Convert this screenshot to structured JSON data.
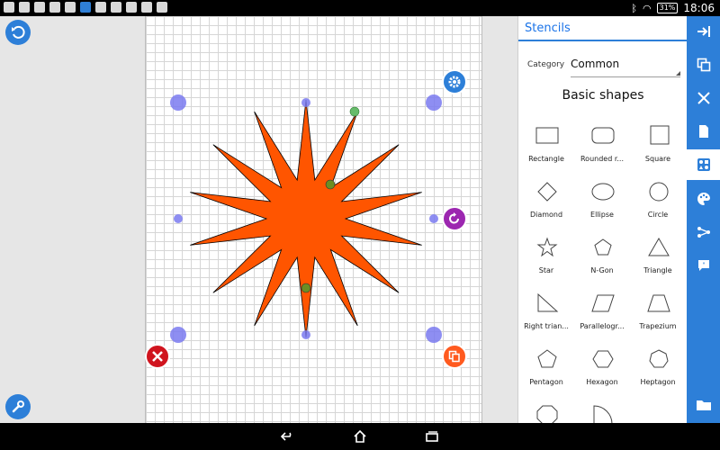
{
  "status": {
    "battery": "31%",
    "time": "18:06"
  },
  "stencils": {
    "title": "Stencils",
    "category_label": "Category",
    "category_value": "Common",
    "section_title": "Basic shapes",
    "shapes": [
      {
        "label": "Rectangle",
        "icon": "rectangle-shape-icon"
      },
      {
        "label": "Rounded r...",
        "icon": "rounded-rectangle-shape-icon"
      },
      {
        "label": "Square",
        "icon": "square-shape-icon"
      },
      {
        "label": "Diamond",
        "icon": "diamond-shape-icon"
      },
      {
        "label": "Ellipse",
        "icon": "ellipse-shape-icon"
      },
      {
        "label": "Circle",
        "icon": "circle-shape-icon"
      },
      {
        "label": "Star",
        "icon": "star-shape-icon"
      },
      {
        "label": "N-Gon",
        "icon": "ngon-shape-icon"
      },
      {
        "label": "Triangle",
        "icon": "triangle-shape-icon"
      },
      {
        "label": "Right trian...",
        "icon": "right-triangle-shape-icon"
      },
      {
        "label": "Parallelogr...",
        "icon": "parallelogram-shape-icon"
      },
      {
        "label": "Trapezium",
        "icon": "trapezium-shape-icon"
      },
      {
        "label": "Pentagon",
        "icon": "pentagon-shape-icon"
      },
      {
        "label": "Hexagon",
        "icon": "hexagon-shape-icon"
      },
      {
        "label": "Heptagon",
        "icon": "heptagon-shape-icon"
      },
      {
        "label": "",
        "icon": "octagon-shape-icon"
      },
      {
        "label": "",
        "icon": "quarter-circle-shape-icon"
      }
    ]
  },
  "colors": {
    "accent": "#2d7fd8",
    "star_fill": "#ff5500",
    "delete": "#d0141e",
    "rotate": "#9c27b0",
    "duplicate": "#ff5a1f",
    "handle": "#7a7af0"
  }
}
